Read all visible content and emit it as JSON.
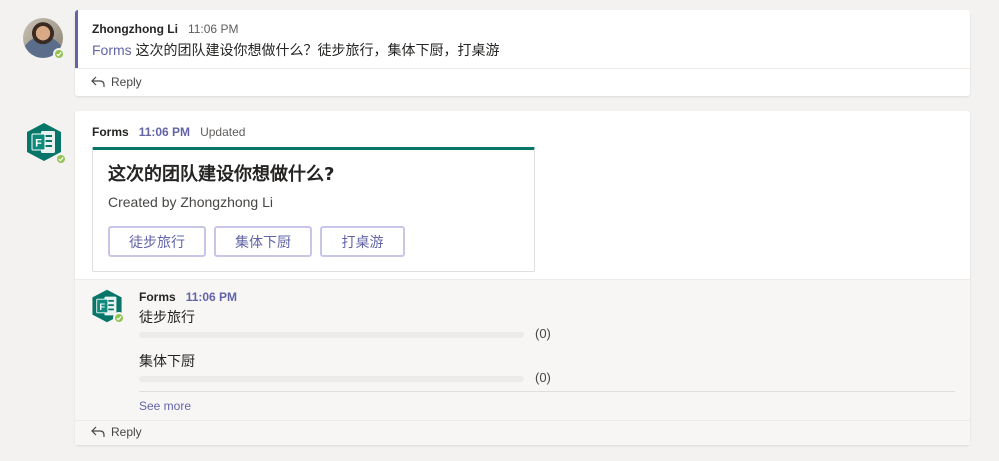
{
  "message1": {
    "sender": "Zhongzhong Li",
    "time": "11:06 PM",
    "mention": "Forms",
    "text": " 这次的团队建设你想做什么？徒步旅行，集体下厨，打桌游",
    "reply_label": "Reply"
  },
  "message2": {
    "sender": "Forms",
    "time": "11:06 PM",
    "status": "Updated",
    "poll": {
      "title": "这次的团队建设你想做什么?",
      "created_by": "Created by Zhongzhong Li",
      "options": [
        "徒步旅行",
        "集体下厨",
        "打桌游"
      ]
    },
    "results": {
      "sender": "Forms",
      "time": "11:06 PM",
      "items": [
        {
          "label": "徒步旅行",
          "count": "(0)",
          "fraction": 0
        },
        {
          "label": "集体下厨",
          "count": "(0)",
          "fraction": 0
        }
      ],
      "see_more": "See more"
    },
    "reply_label": "Reply"
  },
  "colors": {
    "accent": "#6264a7",
    "forms_green": "#077568",
    "presence": "#92c353"
  },
  "icons": [
    "forms-logo-icon",
    "reply-arrow-icon",
    "presence-check-icon",
    "user-avatar"
  ]
}
